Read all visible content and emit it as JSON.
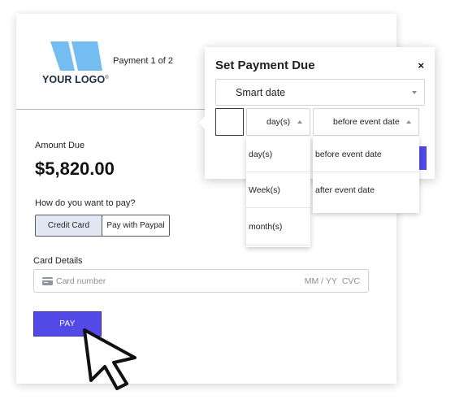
{
  "card": {
    "logo_text": "YOUR LOGO",
    "logo_mark": "®",
    "step": "Payment 1 of 2",
    "amount_label": "Amount Due",
    "amount_value": "$5,820.00",
    "pay_question": "How do you want to pay?",
    "methods": [
      {
        "label": "Credit Card",
        "active": true
      },
      {
        "label": "Pay with Paypal",
        "active": false
      }
    ],
    "card_details_label": "Card Details",
    "card_number_placeholder": "Card number",
    "expiry_placeholder": "MM / YY",
    "cvc_placeholder": "CVC",
    "pay_label": "PAY"
  },
  "dialog": {
    "title": "Set Payment Due",
    "close_glyph": "×",
    "smart_select_value": "Smart date",
    "unit_value": "day(s)",
    "relation_value": "before event date",
    "unit_options": [
      "day(s)",
      "Week(s)",
      "month(s)"
    ],
    "relation_options": [
      "before event date",
      "after event date"
    ]
  },
  "colors": {
    "accent": "#5249e6",
    "logo_blue": "#74bdf0",
    "logo_text": "#1f2a44",
    "active_method_bg": "#e2e8f3"
  },
  "icons": {
    "logo": "logo-shape-icon",
    "credit_card": "credit-card-icon",
    "cursor": "pointer-cursor-icon",
    "close": "close-icon",
    "caret_down": "chevron-down-icon",
    "caret_up": "chevron-up-icon"
  }
}
